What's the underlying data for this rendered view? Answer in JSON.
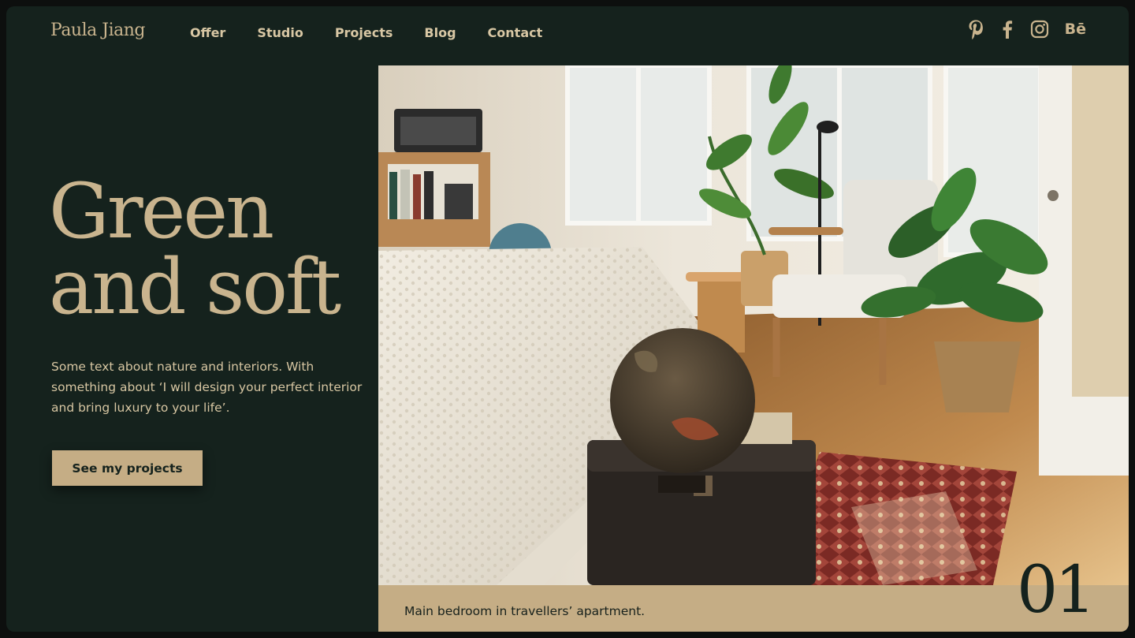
{
  "brand": "Paula Jiang",
  "nav": {
    "items": [
      "Offer",
      "Studio",
      "Projects",
      "Blog",
      "Contact"
    ],
    "social": [
      "pinterest-icon",
      "facebook-icon",
      "instagram-icon",
      "behance-icon"
    ],
    "behance_label": "Bē"
  },
  "hero": {
    "headline_line1": "Green",
    "headline_line2": "and soft",
    "description": "Some text about nature and interiors. With something about ‘I will design your perfect interior and bring luxury to your life’.",
    "cta_label": "See my projects"
  },
  "photo": {
    "caption": "Main bedroom in travellers’ apartment.",
    "slide_number": "01"
  },
  "colors": {
    "background": "#15221d",
    "accent": "#c5ad85",
    "text_light": "#d8c7a4"
  }
}
